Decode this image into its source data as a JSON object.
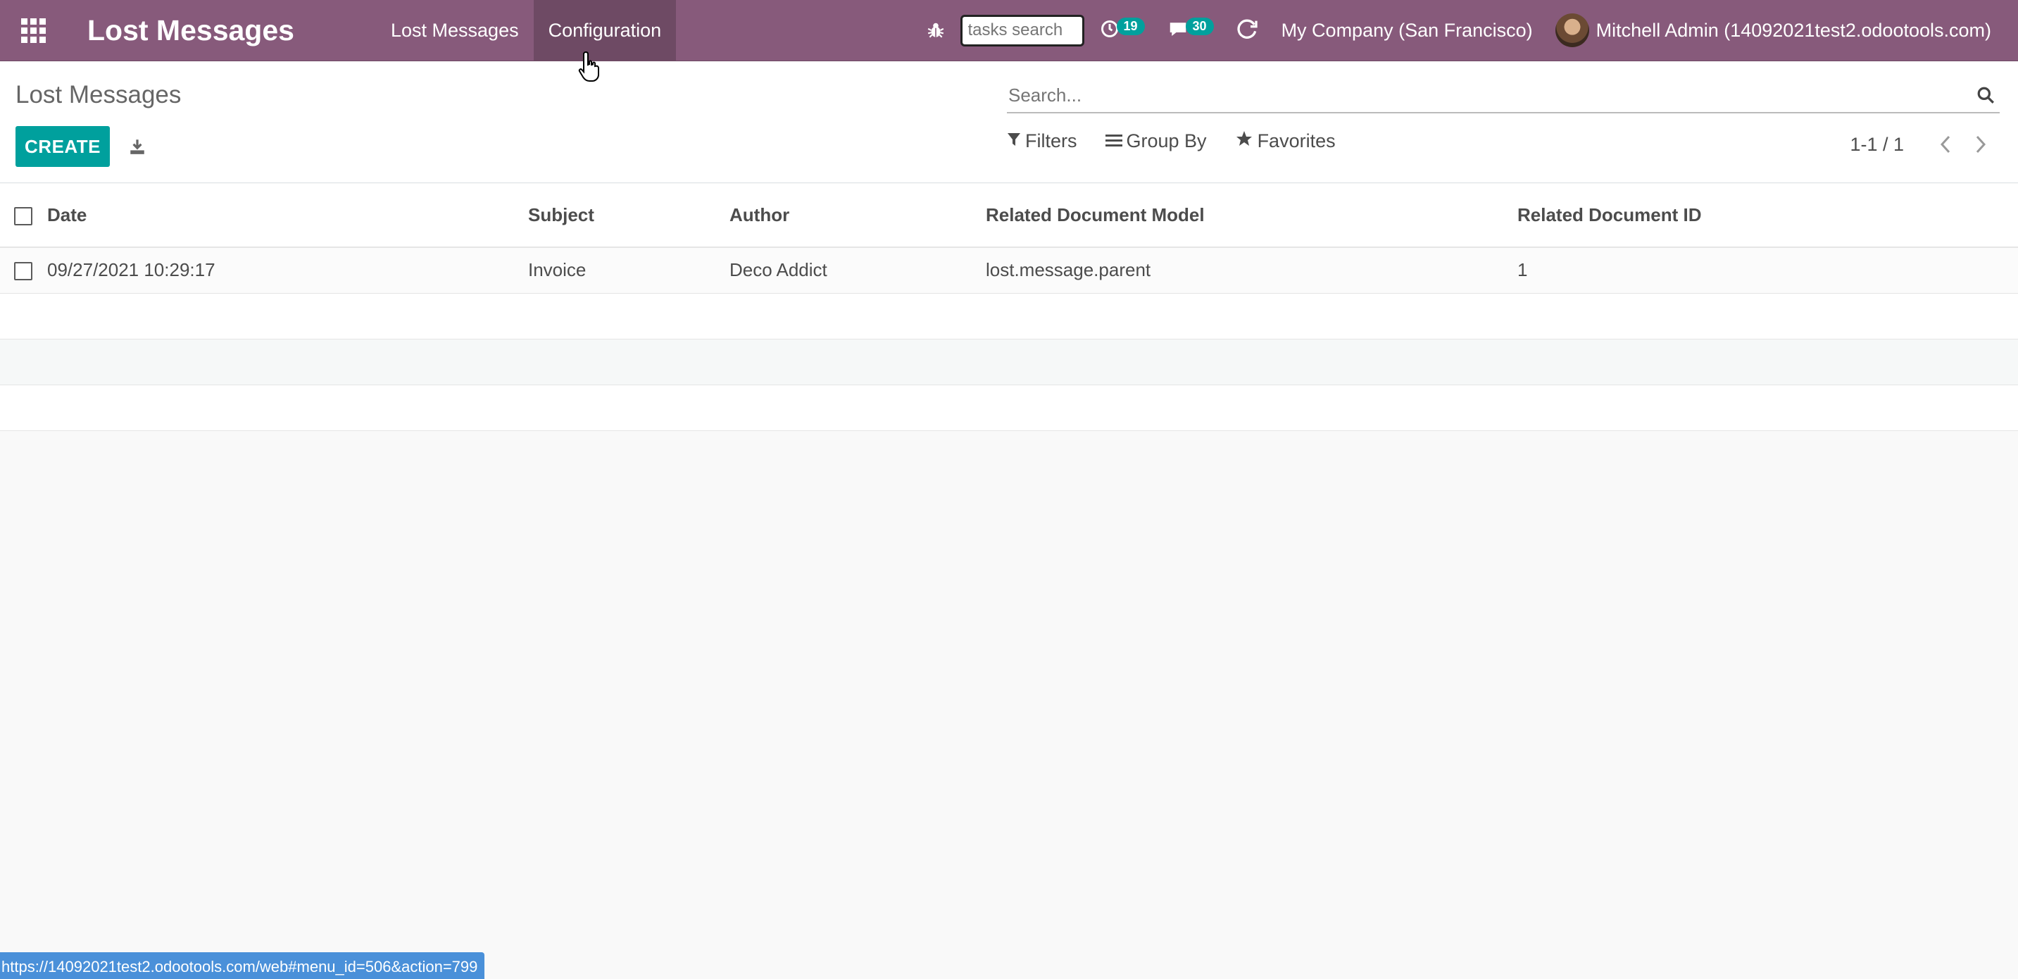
{
  "navbar": {
    "app_title": "Lost Messages",
    "menu": [
      {
        "label": "Lost Messages"
      },
      {
        "label": "Configuration"
      }
    ],
    "tasks_search_placeholder": "tasks search",
    "activity_count": "19",
    "messages_count": "30",
    "company": "My Company (San Francisco)",
    "user": "Mitchell Admin (14092021test2.odootools.com)"
  },
  "control_panel": {
    "breadcrumb": "Lost Messages",
    "create_label": "CREATE",
    "search_placeholder": "Search...",
    "filters_label": "Filters",
    "groupby_label": "Group By",
    "favorites_label": "Favorites",
    "pager_value": "1-1 / 1"
  },
  "table": {
    "headers": {
      "date": "Date",
      "subject": "Subject",
      "author": "Author",
      "model": "Related Document Model",
      "doc_id": "Related Document ID"
    },
    "rows": [
      {
        "date": "09/27/2021 10:29:17",
        "subject": "Invoice",
        "author": "Deco Addict",
        "model": "lost.message.parent",
        "doc_id": "1"
      }
    ]
  },
  "status_url": "https://14092021test2.odootools.com/web#menu_id=506&action=799",
  "colors": {
    "navbar": "#875a7b",
    "accent": "#00a09d",
    "status_bar": "#4a90d9"
  }
}
